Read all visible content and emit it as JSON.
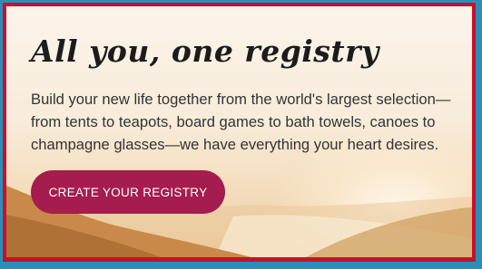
{
  "banner": {
    "headline": "All you, one registry",
    "body": "Build your new life together from the world's largest selection—from tents to teapots, board games to bath towels, canoes to champagne glasses—we have everything your heart desires.",
    "cta_label": "CREATE YOUR REGISTRY"
  },
  "colors": {
    "frame_border": "#c8102e",
    "page_background": "#2a8fb8",
    "cta_background": "#a51c4e",
    "cta_text": "#ffffff"
  }
}
